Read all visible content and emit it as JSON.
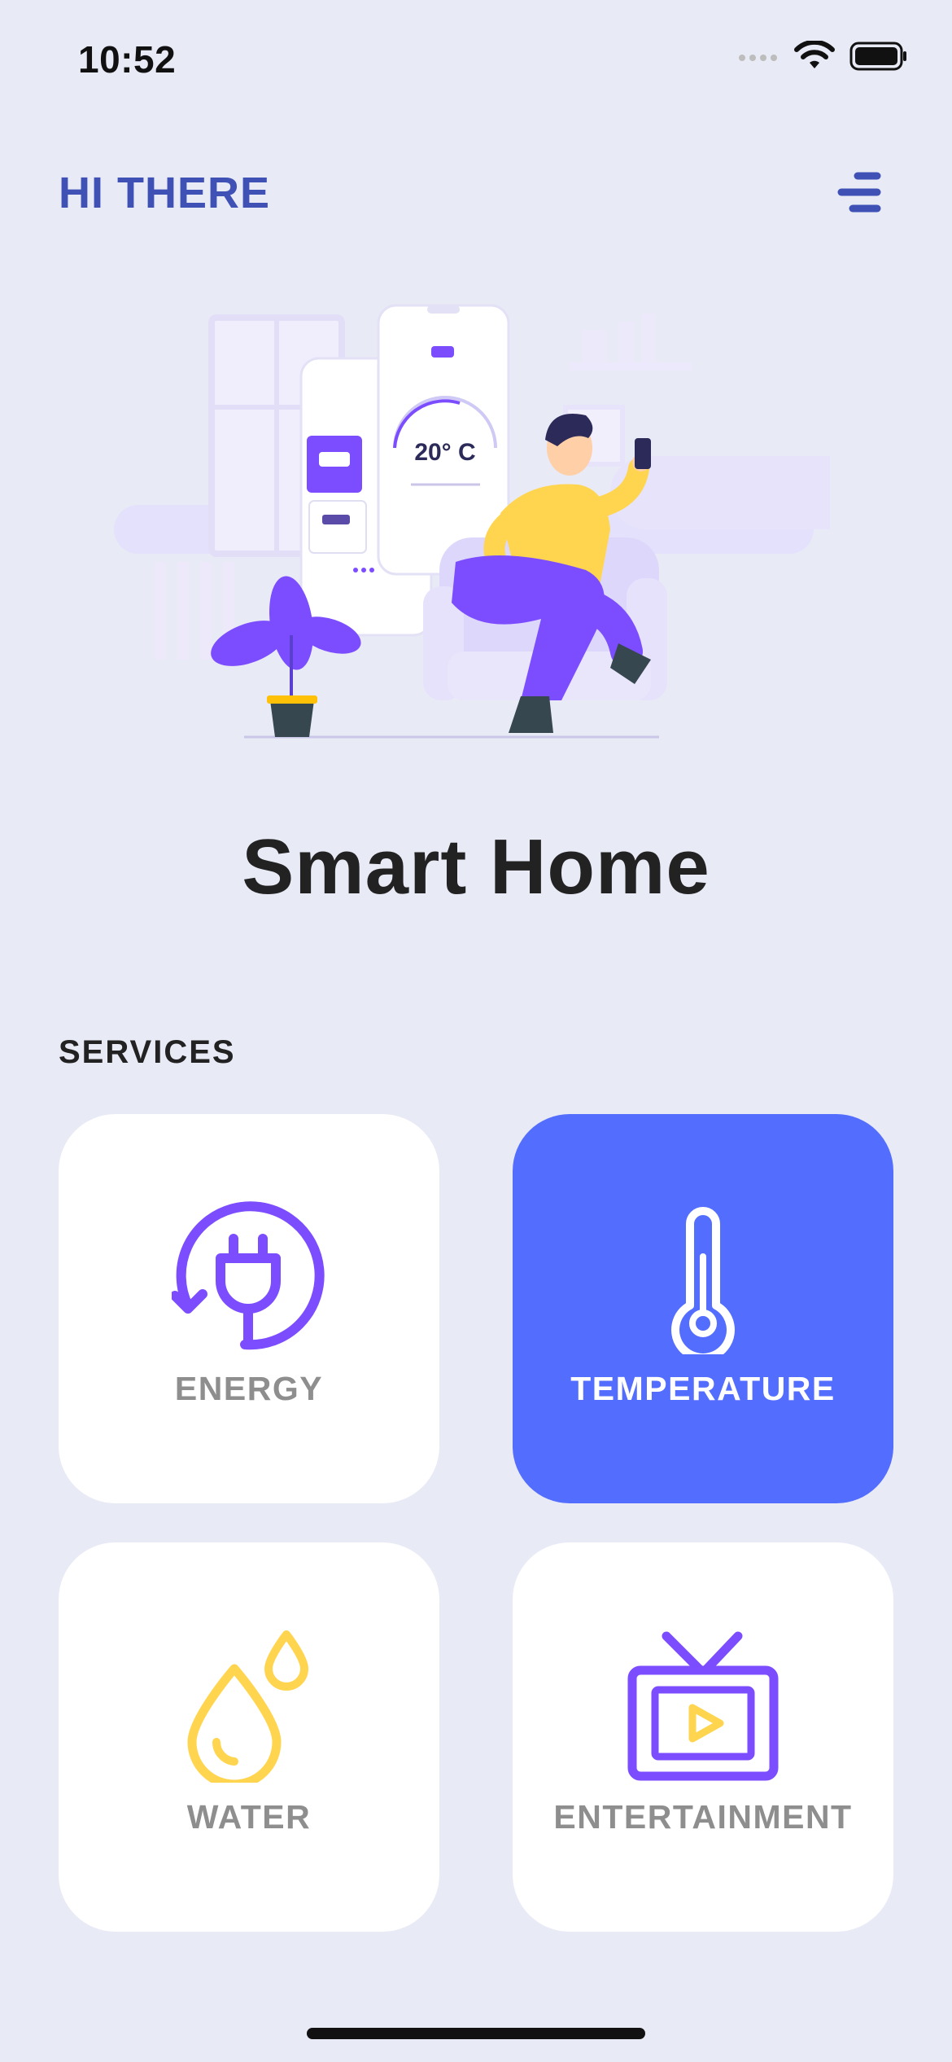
{
  "status_bar": {
    "time": "10:52"
  },
  "header": {
    "greeting": "HI THERE"
  },
  "illustration": {
    "screen_reading": "20° C"
  },
  "page": {
    "title": "Smart Home"
  },
  "services": {
    "label": "SERVICES",
    "items": [
      {
        "label": "ENERGY",
        "icon": "plug-refresh-icon",
        "active": false,
        "accent": "#7c4dff"
      },
      {
        "label": "TEMPERATURE",
        "icon": "thermometer-icon",
        "active": true,
        "accent": "#ffffff"
      },
      {
        "label": "WATER",
        "icon": "water-drop-icon",
        "active": false,
        "accent": "#ffd54f"
      },
      {
        "label": "ENTERTAINMENT",
        "icon": "tv-icon",
        "active": false,
        "accent": "#7c4dff"
      }
    ]
  },
  "colors": {
    "background": "#e8eaf6",
    "brand": "#3f51b5",
    "active_card": "#536dfe",
    "inactive_label": "#8e8e8e"
  }
}
